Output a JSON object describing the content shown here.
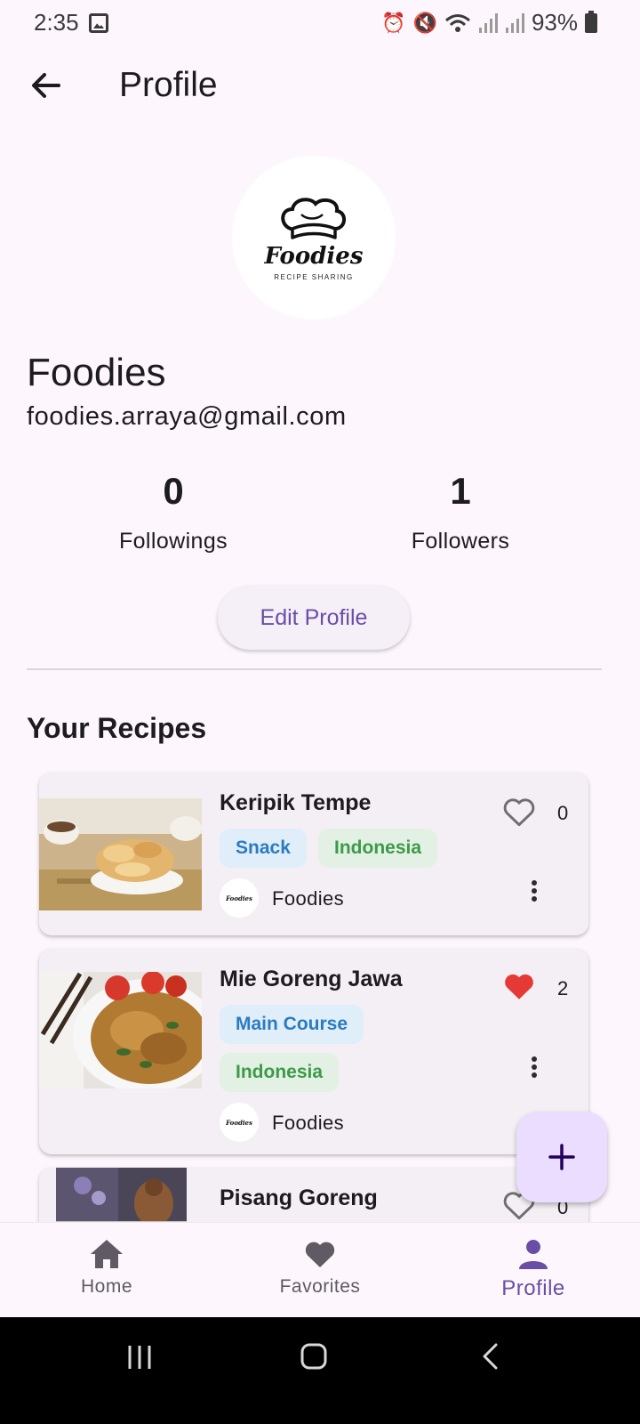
{
  "status_bar": {
    "time": "2:35",
    "battery": "93%",
    "icons": [
      "image-icon",
      "alarm-icon",
      "mute-icon",
      "wifi-icon",
      "signal-icon",
      "signal-icon",
      "battery-icon"
    ]
  },
  "app_bar": {
    "title": "Profile",
    "back_icon": "arrow-back-icon"
  },
  "profile": {
    "logo_text": "Foodies",
    "logo_tagline": "RECIPE SHARING",
    "name": "Foodies",
    "email": "foodies.arraya@gmail.com",
    "followings_count": "0",
    "followings_label": "Followings",
    "followers_count": "1",
    "followers_label": "Followers",
    "edit_button": "Edit Profile"
  },
  "recipes_section": {
    "title": "Your Recipes",
    "recipes": [
      {
        "title": "Keripik Tempe",
        "tags": [
          "Snack",
          "Indonesia"
        ],
        "author": "Foodies",
        "likes": "0",
        "liked": false
      },
      {
        "title": "Mie Goreng Jawa",
        "tags": [
          "Main Course",
          "Indonesia"
        ],
        "author": "Foodies",
        "likes": "2",
        "liked": true
      },
      {
        "title": "Pisang Goreng",
        "tags": [],
        "author": "",
        "likes": "0",
        "liked": false
      }
    ]
  },
  "fab": {
    "icon": "plus-icon"
  },
  "bottom_nav": {
    "items": [
      {
        "label": "Home",
        "icon": "home-icon",
        "active": false
      },
      {
        "label": "Favorites",
        "icon": "heart-icon",
        "active": false
      },
      {
        "label": "Profile",
        "icon": "person-icon",
        "active": true
      }
    ]
  },
  "colors": {
    "background": "#fdf7fd",
    "accent": "#6a4ea6",
    "like_red": "#e53935",
    "chip_blue": "#2b7bc0",
    "chip_green": "#3d9a48",
    "fab_bg": "#eaddff"
  }
}
